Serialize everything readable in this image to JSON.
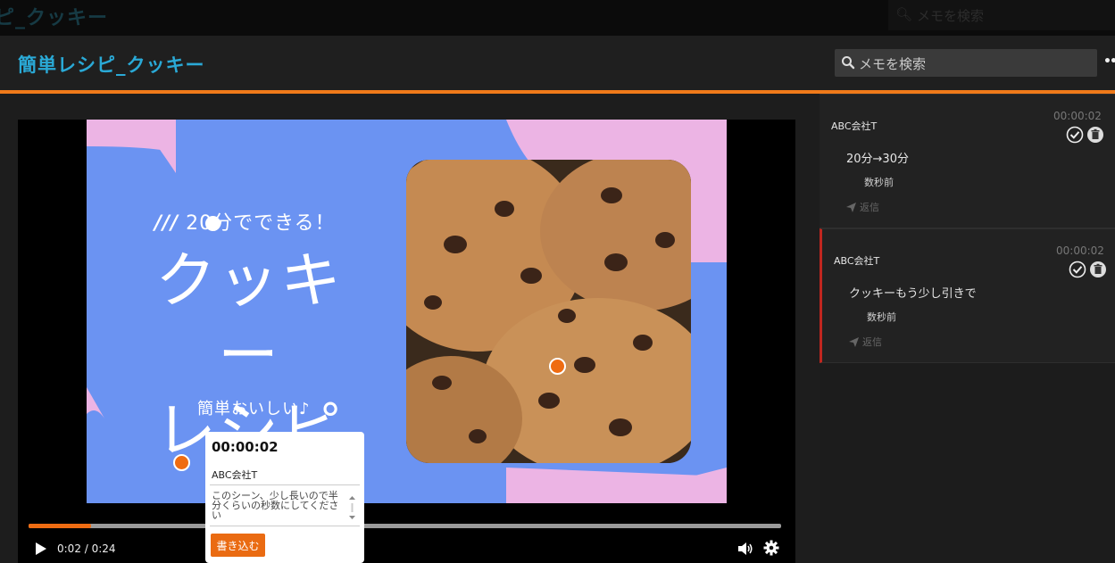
{
  "ghost": {
    "title": "ピ_クッキー",
    "search_placeholder": "メモを検索"
  },
  "header": {
    "title": "簡単レシピ_クッキー",
    "search_placeholder": "メモを検索",
    "more_label": "•••"
  },
  "slide": {
    "kicker": "20分でできる！",
    "title_line1": "クッキー",
    "title_line2": "レシピ",
    "subtitle": "簡単おいしい♪"
  },
  "player": {
    "time": "0:02 / 0:24",
    "progress": 0.083
  },
  "popup": {
    "timestamp": "00:00:02",
    "author": "ABC会社T",
    "note": "このシーン、少し長いので半分くらいの秒数にしてください",
    "submit_label": "書き込む"
  },
  "comments": [
    {
      "author": "ABC会社T",
      "time": "00:00:02",
      "body": "20分→30分",
      "ago": "数秒前",
      "reply": "返信"
    },
    {
      "author": "ABC会社T",
      "time": "00:00:02",
      "body": "クッキーもう少し引きで",
      "ago": "数秒前",
      "reply": "返信"
    }
  ],
  "colors": {
    "accent": "#ef6c12",
    "title": "#2aa9d6",
    "slide_blue": "#6b93f2",
    "slide_pink": "#ecb4e4"
  }
}
